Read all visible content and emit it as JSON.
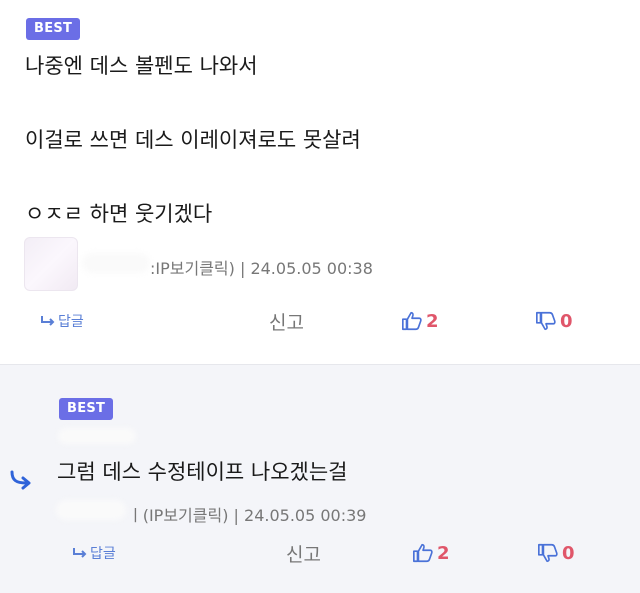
{
  "comment": {
    "badge": "BEST",
    "lines": [
      "나중엔 데스 볼펜도 나와서",
      "이걸로 쓰면 데스 이레이져로도 못살려",
      "ㅇㅈㄹ 하면 웃기겠다"
    ],
    "meta": ":IP보기클릭) | 24.05.05 00:38",
    "reply_label": "답글",
    "report_label": "신고",
    "upvotes": "2",
    "downvotes": "0"
  },
  "reply": {
    "badge": "BEST",
    "text": "그럼 데스 수정테이프 나오겠는걸",
    "meta": "ㅣ(IP보기클릭) | 24.05.05 00:39",
    "reply_label": "답글",
    "report_label": "신고",
    "upvotes": "2",
    "downvotes": "0"
  },
  "colors": {
    "badge": "#6b6ee6",
    "vote": "#e0566a",
    "link": "#5a7fd6",
    "reply_bg": "#f4f5f9"
  }
}
